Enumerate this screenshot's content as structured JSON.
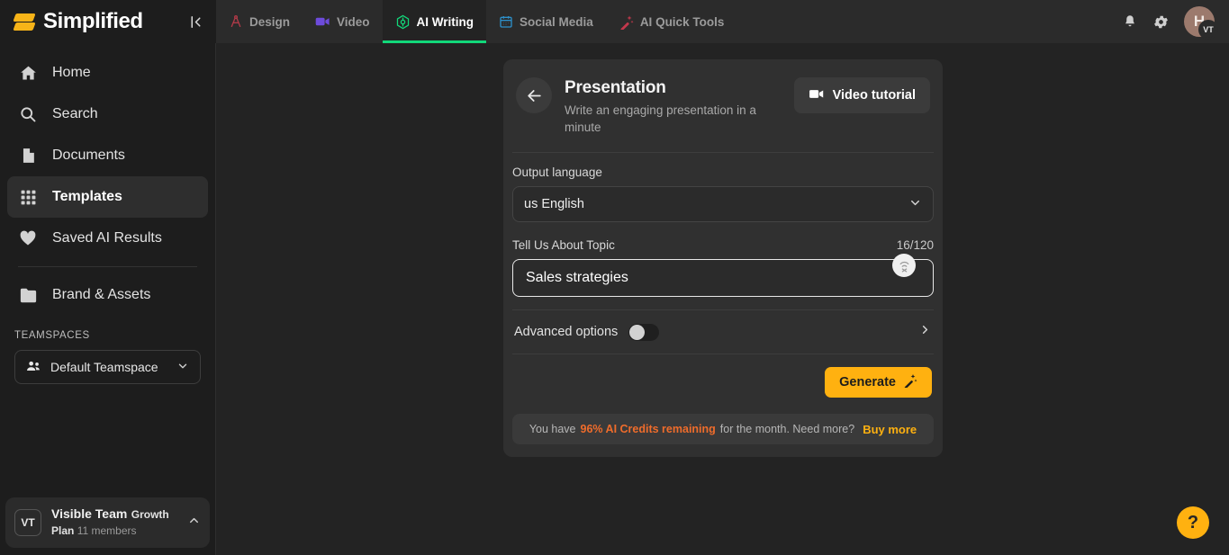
{
  "brand": {
    "name": "Simplified",
    "collapse_icon": "collapse-sidebar-icon"
  },
  "tabs": [
    {
      "label": "Design",
      "icon": "compass-icon",
      "color": "#b03a48",
      "active": false
    },
    {
      "label": "Video",
      "icon": "video-camera-icon",
      "color": "#6d4bdb",
      "active": false
    },
    {
      "label": "AI Writing",
      "icon": "ai-hexagon-icon",
      "color": "#12d87a",
      "active": true
    },
    {
      "label": "Social Media",
      "icon": "calendar-icon",
      "color": "#2d8fc9",
      "active": false
    },
    {
      "label": "AI Quick Tools",
      "icon": "magic-wand-icon",
      "color": "#c2384c",
      "active": false
    }
  ],
  "topright": {
    "notifications_icon": "bell-icon",
    "settings_icon": "gear-icon",
    "avatar_letter": "H",
    "avatar_badge": "VT"
  },
  "sidebar": {
    "items": [
      {
        "label": "Home",
        "icon": "home-icon",
        "active": false
      },
      {
        "label": "Search",
        "icon": "search-icon",
        "active": false
      },
      {
        "label": "Documents",
        "icon": "document-icon",
        "active": false
      },
      {
        "label": "Templates",
        "icon": "grid-icon",
        "active": true
      },
      {
        "label": "Saved AI Results",
        "icon": "heart-icon",
        "active": false
      },
      {
        "label": "Brand & Assets",
        "icon": "folder-icon",
        "active": false
      }
    ],
    "teamspaces_label": "TEAMSPACES",
    "teamspace_selected": "Default Teamspace",
    "team": {
      "initials": "VT",
      "name": "Visible Team",
      "plan": "Growth Plan",
      "members": "11 members"
    }
  },
  "card": {
    "back_icon": "back-arrow-icon",
    "title": "Presentation",
    "subtitle": "Write an engaging presentation in a minute",
    "tutorial_label": "Video tutorial",
    "tutorial_icon": "video-camera-icon",
    "output_language_label": "Output language",
    "output_language_value": "us English",
    "topic_label": "Tell Us About Topic",
    "topic_counter": "16/120",
    "topic_value": "Sales strategies",
    "topic_mic_icon": "microphone-icon",
    "advanced_label": "Advanced options",
    "advanced_toggle_state": "off",
    "generate_label": "Generate",
    "generate_icon": "magic-wand-icon",
    "credits": {
      "prefix": "You have",
      "highlight": "96% AI Credits remaining",
      "middle": "for the month. Need more?",
      "buy": "Buy more"
    }
  },
  "help": {
    "icon": "question-mark-icon",
    "label": "?"
  },
  "colors": {
    "accent": "#ffb110",
    "active_tab": "#12d87a",
    "credits_highlight": "#ef6c2b",
    "background": "#232323",
    "card": "#303030",
    "sidebar": "#1d1d1d"
  }
}
